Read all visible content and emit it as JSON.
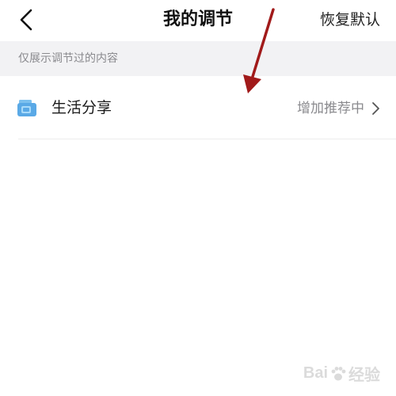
{
  "nav": {
    "title": "我的调节",
    "reset_label": "恢复默认",
    "back_icon": "chevron-left-icon"
  },
  "section": {
    "header_text": "仅展示调节过的内容"
  },
  "rows": [
    {
      "icon": "video-camera-icon",
      "label": "生活分享",
      "value": "增加推荐中"
    }
  ],
  "watermark": {
    "text_latin": "Bai",
    "text_cjk": "经验"
  },
  "colors": {
    "accent_icon": "#5aa9e6",
    "annotation_arrow": "#a11a1a",
    "section_bg": "#f2f2f4",
    "secondary_text": "#8a8a8e"
  }
}
